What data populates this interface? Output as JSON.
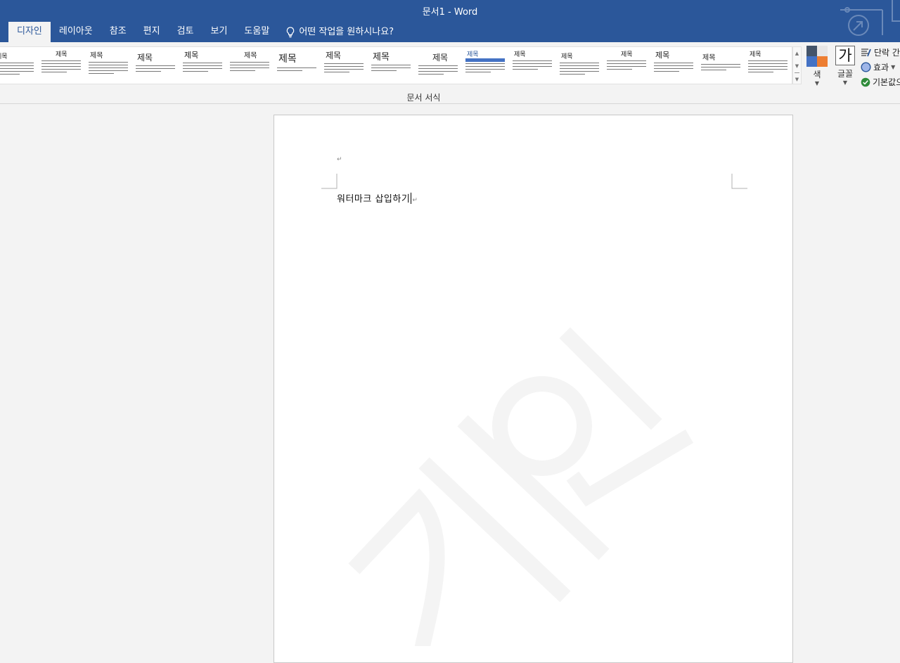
{
  "window": {
    "title": "문서1  -  Word"
  },
  "tabs": [
    {
      "label": "디자인",
      "active": true
    },
    {
      "label": "레이아웃"
    },
    {
      "label": "참조"
    },
    {
      "label": "편지"
    },
    {
      "label": "검토"
    },
    {
      "label": "보기"
    },
    {
      "label": "도움말"
    }
  ],
  "tell_me": {
    "text": "어떤 작업을 원하시나요?"
  },
  "ribbon": {
    "gallery_label": "문서 서식",
    "theme_heading": "제목",
    "colors_label": "색",
    "fonts_label": "글꼴",
    "fonts_glyph": "가",
    "paragraph_spacing_label": "단락 간",
    "effects_label": "효과",
    "set_default_label": "기본값으",
    "swatch_colors": [
      "#44546a",
      "#e7e6e6",
      "#4472c4",
      "#ed7d31"
    ]
  },
  "document": {
    "body_text": "워터마크 삽입하기",
    "paragraph_mark": "↵",
    "watermark_text": "개인"
  },
  "colors": {
    "accent": "#2b579a"
  }
}
